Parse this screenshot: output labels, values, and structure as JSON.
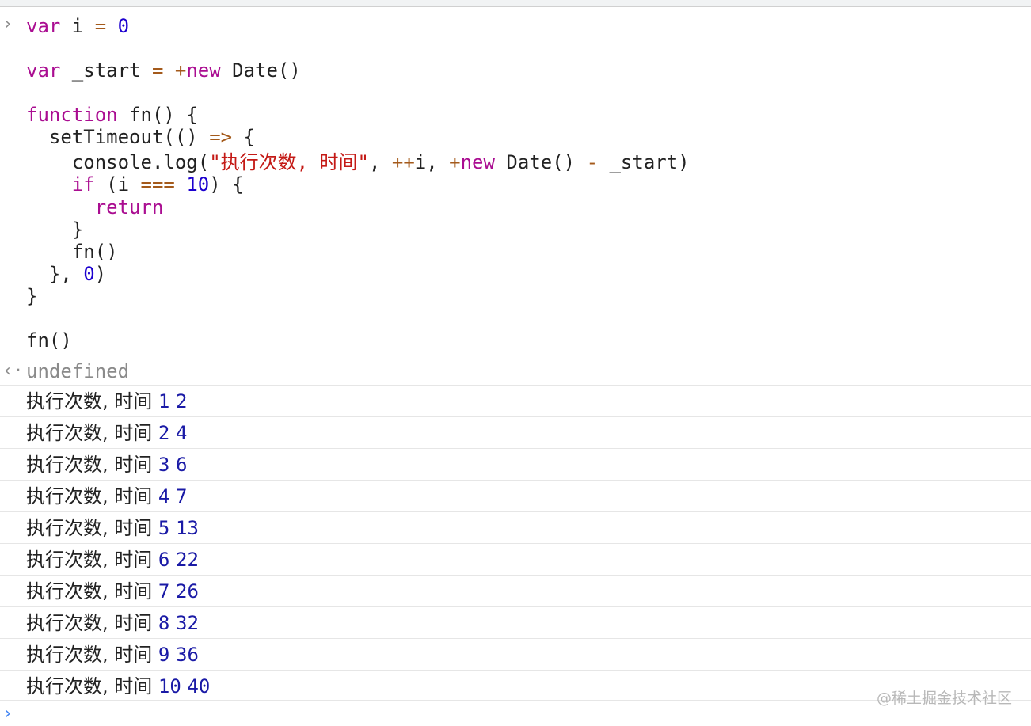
{
  "input": {
    "prompt_icon": "chevron-right-icon",
    "code_lines": [
      [
        {
          "t": "var",
          "c": "kw"
        },
        {
          "t": " i ",
          "c": "plain"
        },
        {
          "t": "=",
          "c": "op"
        },
        {
          "t": " ",
          "c": "plain"
        },
        {
          "t": "0",
          "c": "num"
        }
      ],
      [],
      [
        {
          "t": "var",
          "c": "kw"
        },
        {
          "t": " _start ",
          "c": "plain"
        },
        {
          "t": "=",
          "c": "op"
        },
        {
          "t": " ",
          "c": "plain"
        },
        {
          "t": "+",
          "c": "op"
        },
        {
          "t": "new",
          "c": "kw"
        },
        {
          "t": " Date()",
          "c": "plain"
        }
      ],
      [],
      [
        {
          "t": "function",
          "c": "kw"
        },
        {
          "t": " fn() {",
          "c": "plain"
        }
      ],
      [
        {
          "t": "  setTimeout(() ",
          "c": "plain"
        },
        {
          "t": "=>",
          "c": "op"
        },
        {
          "t": " {",
          "c": "plain"
        }
      ],
      [
        {
          "t": "    console.log(",
          "c": "plain"
        },
        {
          "t": "\"执行次数, 时间\"",
          "c": "str"
        },
        {
          "t": ", ",
          "c": "plain"
        },
        {
          "t": "++",
          "c": "op"
        },
        {
          "t": "i, ",
          "c": "plain"
        },
        {
          "t": "+",
          "c": "op"
        },
        {
          "t": "new",
          "c": "kw"
        },
        {
          "t": " Date() ",
          "c": "plain"
        },
        {
          "t": "-",
          "c": "op"
        },
        {
          "t": " _start)",
          "c": "plain"
        }
      ],
      [
        {
          "t": "    ",
          "c": "plain"
        },
        {
          "t": "if",
          "c": "kw"
        },
        {
          "t": " (i ",
          "c": "plain"
        },
        {
          "t": "===",
          "c": "op"
        },
        {
          "t": " ",
          "c": "plain"
        },
        {
          "t": "10",
          "c": "num"
        },
        {
          "t": ") {",
          "c": "plain"
        }
      ],
      [
        {
          "t": "      ",
          "c": "plain"
        },
        {
          "t": "return",
          "c": "kw"
        }
      ],
      [
        {
          "t": "    }",
          "c": "plain"
        }
      ],
      [
        {
          "t": "    fn()",
          "c": "plain"
        }
      ],
      [
        {
          "t": "  }, ",
          "c": "plain"
        },
        {
          "t": "0",
          "c": "num"
        },
        {
          "t": ")",
          "c": "plain"
        }
      ],
      [
        {
          "t": "}",
          "c": "plain"
        }
      ],
      [],
      [
        {
          "t": "fn()",
          "c": "plain"
        }
      ]
    ]
  },
  "result": {
    "icon": "return-arrow-icon",
    "text": "undefined"
  },
  "logs": [
    {
      "label": "执行次数, 时间",
      "count": "1",
      "time": "2"
    },
    {
      "label": "执行次数, 时间",
      "count": "2",
      "time": "4"
    },
    {
      "label": "执行次数, 时间",
      "count": "3",
      "time": "6"
    },
    {
      "label": "执行次数, 时间",
      "count": "4",
      "time": "7"
    },
    {
      "label": "执行次数, 时间",
      "count": "5",
      "time": "13"
    },
    {
      "label": "执行次数, 时间",
      "count": "6",
      "time": "22"
    },
    {
      "label": "执行次数, 时间",
      "count": "7",
      "time": "26"
    },
    {
      "label": "执行次数, 时间",
      "count": "8",
      "time": "32"
    },
    {
      "label": "执行次数, 时间",
      "count": "9",
      "time": "36"
    },
    {
      "label": "执行次数, 时间",
      "count": "10",
      "time": "40"
    }
  ],
  "console_input": {
    "prompt_icon": "chevron-right-icon",
    "value": ""
  },
  "watermark": "@稀土掘金技术社区",
  "colors": {
    "keyword": "#aa0d91",
    "number": "#1c00cf",
    "operator": "#a45a1b",
    "string": "#c41a16",
    "log_number": "#1a1aa6",
    "prompt_active": "#4285f4"
  }
}
